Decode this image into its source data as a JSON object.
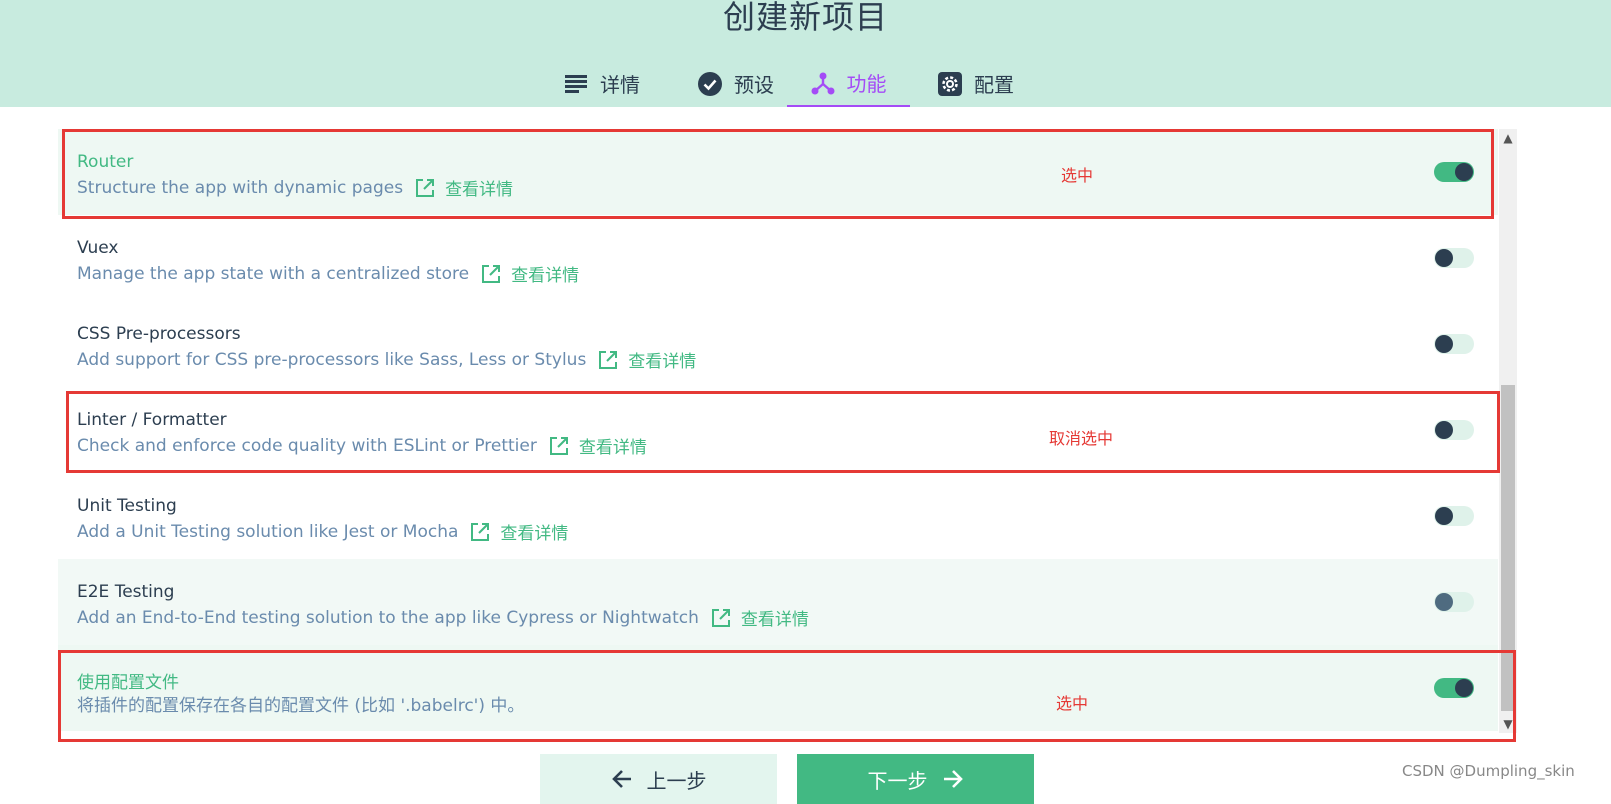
{
  "header": {
    "title": "创建新项目",
    "tabs": [
      {
        "label": "详情",
        "icon": "list-icon",
        "active": false
      },
      {
        "label": "预设",
        "icon": "check-circle-icon",
        "active": false
      },
      {
        "label": "功能",
        "icon": "branch-icon",
        "active": true
      },
      {
        "label": "配置",
        "icon": "gear-icon",
        "active": false
      }
    ]
  },
  "features": [
    {
      "name": "Router",
      "description": "Structure the app with dynamic pages",
      "link": "查看详情",
      "enabled": true
    },
    {
      "name": "Vuex",
      "description": "Manage the app state with a centralized store",
      "link": "查看详情",
      "enabled": false
    },
    {
      "name": "CSS Pre-processors",
      "description": "Add support for CSS pre-processors like Sass, Less or Stylus",
      "link": "查看详情",
      "enabled": false
    },
    {
      "name": "Linter / Formatter",
      "description": "Check and enforce code quality with ESLint or Prettier",
      "link": "查看详情",
      "enabled": false
    },
    {
      "name": "Unit Testing",
      "description": "Add a Unit Testing solution like Jest or Mocha",
      "link": "查看详情",
      "enabled": false
    },
    {
      "name": "E2E Testing",
      "description": "Add an End-to-End testing solution to the app like Cypress or Nightwatch",
      "link": "查看详情",
      "enabled": false
    },
    {
      "name": "使用配置文件",
      "description": "将插件的配置保存在各自的配置文件 (比如 '.babelrc') 中。",
      "link": "",
      "enabled": true
    }
  ],
  "annotations": {
    "router": "选中",
    "linter": "取消选中",
    "config_file": "选中"
  },
  "footer": {
    "prev_label": "上一步",
    "next_label": "下一步",
    "watermark": "CSDN @Dumpling_skin"
  },
  "colors": {
    "header_bg": "#c8ebdf",
    "accent_green": "#42b983",
    "active_tab": "#a44cf6",
    "annotation_red": "#e53935"
  }
}
